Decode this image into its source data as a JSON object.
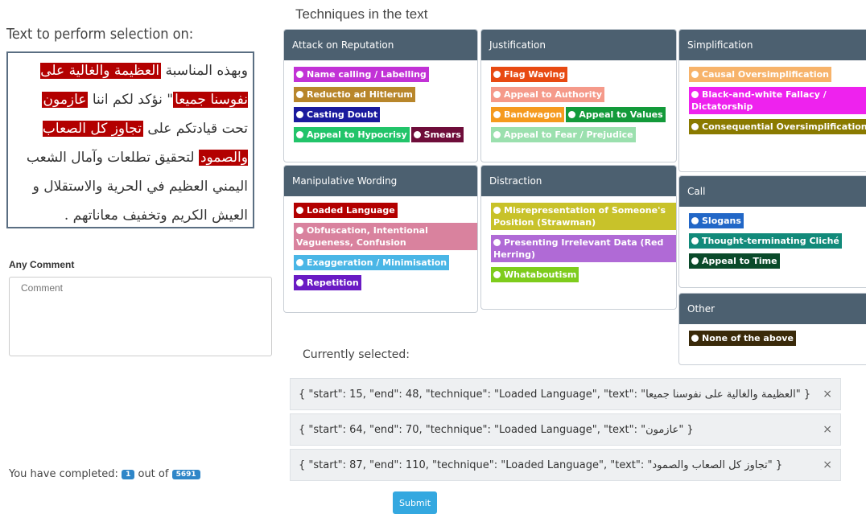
{
  "techniques_heading": "Techniques in the text",
  "selection_label": "Text to perform selection on:",
  "text_segments": [
    {
      "t": "وبهذه المناسبة ",
      "hl": false
    },
    {
      "t": "العظيمة والغالية على نفوسنا جميعا",
      "hl": true
    },
    {
      "t": "\" نؤكد لكم اننا ",
      "hl": false
    },
    {
      "t": "عازمون",
      "hl": true
    },
    {
      "t": " تحت قيادتكم على ",
      "hl": false
    },
    {
      "t": "تجاوز كل الصعاب والصمود",
      "hl": true
    },
    {
      "t": " لتحقيق تطلعات وآمال الشعب اليمني العظيم في الحرية والاستقلال و العيش الكريم وتخفيف معاناتهم .",
      "hl": false
    }
  ],
  "comment": {
    "label": "Any Comment",
    "placeholder": "Comment"
  },
  "progress": {
    "prefix": "You have completed:",
    "done": "1",
    "middle": "out of",
    "total": "5691"
  },
  "panels": {
    "attack": {
      "title": "Attack on Reputation",
      "rows": [
        [
          {
            "label": "Name calling / Labelling",
            "color": "#c232d6"
          }
        ],
        [
          {
            "label": "Reductio ad Hitlerum",
            "color": "#b8862b"
          }
        ],
        [
          {
            "label": "Casting Doubt",
            "color": "#1a1a9e"
          }
        ],
        [
          {
            "label": "Appeal to Hypocrisy",
            "color": "#22c46a"
          },
          {
            "label": "Smears",
            "color": "#6e0d3a"
          }
        ]
      ]
    },
    "justification": {
      "title": "Justification",
      "rows": [
        [
          {
            "label": "Flag Waving",
            "color": "#e84a12"
          }
        ],
        [
          {
            "label": "Appeal to Authority",
            "color": "#f59a8a"
          }
        ],
        [
          {
            "label": "Bandwagon",
            "color": "#f59a1e"
          },
          {
            "label": "Appeal to Values",
            "color": "#139a3a"
          }
        ],
        [
          {
            "label": "Appeal to Fear / Prejudice",
            "color": "#9be0ae"
          }
        ]
      ]
    },
    "simplification": {
      "title": "Simplification",
      "rows": [
        [
          {
            "label": "Causal Oversimplification",
            "color": "#f7b36a"
          }
        ],
        [
          {
            "label": "Black-and-white Fallacy / Dictatorship",
            "color": "#ee22ee"
          }
        ],
        [
          {
            "label": "Consequential Oversimplification",
            "color": "#8a7a00"
          }
        ]
      ]
    },
    "manipulative": {
      "title": "Manipulative Wording",
      "rows": [
        [
          {
            "label": "Loaded Language",
            "color": "#b30000"
          }
        ],
        [
          {
            "label": "Obfuscation, Intentional Vagueness, Confusion",
            "color": "#d9829e"
          }
        ],
        [
          {
            "label": "Exaggeration / Minimisation",
            "color": "#4ab6e6"
          }
        ],
        [
          {
            "label": "Repetition",
            "color": "#6a1bc4"
          }
        ]
      ]
    },
    "distraction": {
      "title": "Distraction",
      "rows": [
        [
          {
            "label": "Misrepresentation of Someone's Position (Strawman)",
            "color": "#c8c22a"
          }
        ],
        [
          {
            "label": "Presenting Irrelevant Data (Red Herring)",
            "color": "#b06ad6"
          }
        ],
        [
          {
            "label": "Whataboutism",
            "color": "#7ecc1c"
          }
        ]
      ]
    },
    "call": {
      "title": "Call",
      "rows": [
        [
          {
            "label": "Slogans",
            "color": "#2267c7"
          }
        ],
        [
          {
            "label": "Thought-terminating Cliché",
            "color": "#128a7a"
          }
        ],
        [
          {
            "label": "Appeal to Time",
            "color": "#0a4a2a"
          }
        ]
      ]
    },
    "other": {
      "title": "Other",
      "rows": [
        [
          {
            "label": "None of the above",
            "color": "#3a2a0a"
          }
        ]
      ]
    }
  },
  "currently_selected_label": "Currently selected:",
  "selected": [
    "{ \"start\": 15, \"end\": 48, \"technique\": \"Loaded Language\", \"text\": \"العظيمة والغالية على نفوسنا جميعا\" }",
    "{ \"start\": 64, \"end\": 70, \"technique\": \"Loaded Language\", \"text\": \"عازمون\" }",
    "{ \"start\": 87, \"end\": 110, \"technique\": \"Loaded Language\", \"text\": \"تجاوز كل الصعاب والصمود\" }"
  ],
  "close_glyph": "×",
  "submit_label": "Submit"
}
